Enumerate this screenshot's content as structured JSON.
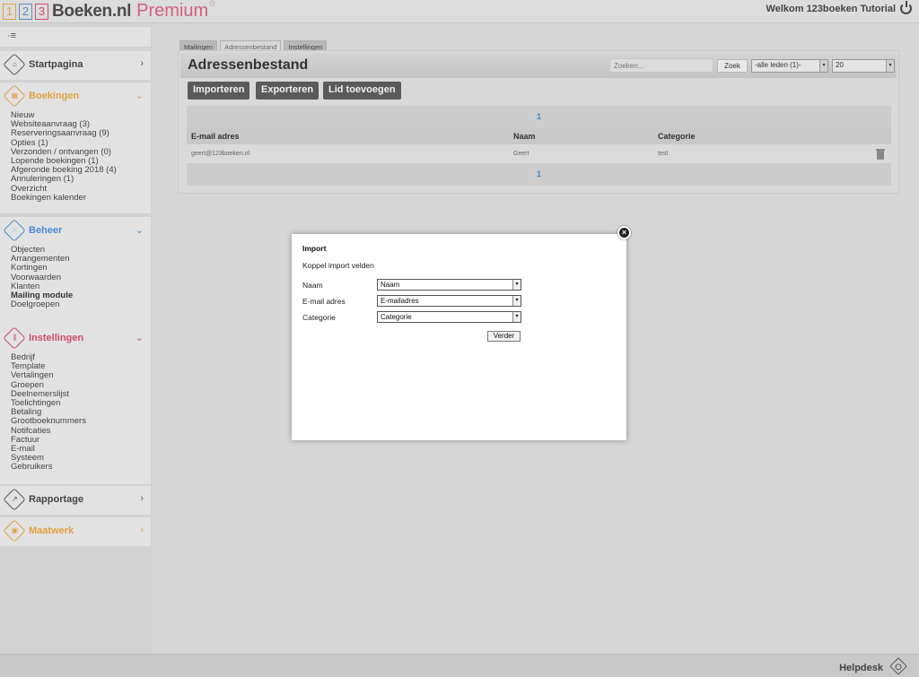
{
  "header": {
    "logo_digits": [
      "1",
      "2",
      "3"
    ],
    "brand": "Boeken.nl",
    "premium": "Premium",
    "star": "☆",
    "welcome": "Welkom 123boeken Tutorial"
  },
  "sidebar": {
    "collapse_glyph": "·≡",
    "startpagina": {
      "title": "Startpagina",
      "chev": "›"
    },
    "boekingen": {
      "title": "Boekingen",
      "chev": "⌄",
      "color": "#e0a040",
      "items": [
        "Nieuw",
        "Websiteaanvraag (3)",
        "Reserveringsaanvraag (9)",
        "Opties (1)",
        "Verzonden / ontvangen (0)",
        "Lopende boekingen (1)",
        "Afgeronde boeking 2018 (4)",
        "Annuleringen (1)",
        "Overzicht",
        "Boekingen kalender"
      ]
    },
    "beheer": {
      "title": "Beheer",
      "chev": "⌄",
      "color": "#4a8ad0",
      "items": [
        "Objecten",
        "Arrangementen",
        "Kortingen",
        "Voorwaarden",
        "Klanten",
        "Mailing module",
        "Doelgroepen"
      ]
    },
    "instellingen": {
      "title": "Instellingen",
      "chev": "⌄",
      "color": "#d04a6a",
      "items": [
        "Bedrijf",
        "Template",
        "Vertalingen",
        "Groepen",
        "Deelnemerslijst",
        "Toelichtingen",
        "Betaling",
        "Grootboeknummers",
        "Notifcaties",
        "Factuur",
        "E-mail",
        "Systeem",
        "Gebruikers"
      ]
    },
    "rapportage": {
      "title": "Rapportage",
      "chev": "›"
    },
    "maatwerk": {
      "title": "Maatwerk",
      "chev": "›",
      "color": "#e0a040"
    }
  },
  "main": {
    "tabs": [
      "Mailingen",
      "Adressenbestand",
      "Instellingen"
    ],
    "title": "Adressenbestand",
    "search_placeholder": "Zoeken...",
    "search_button": "Zoek",
    "filter_value": "-alle leden (1)-",
    "page_size": "20",
    "buttons": [
      "Importeren",
      "Exporteren",
      "Lid toevoegen"
    ],
    "pager": "1",
    "columns": [
      "E-mail adres",
      "Naam",
      "Categorie"
    ],
    "rows": [
      {
        "email": "geert@123boeken.nl",
        "naam": "Geert",
        "categorie": "test"
      }
    ]
  },
  "modal": {
    "title": "Import",
    "subtitle": "Koppel import velden",
    "fields": [
      {
        "label": "Naam",
        "value": "Naam"
      },
      {
        "label": "E-mail adres",
        "value": "E-mailadres"
      },
      {
        "label": "Categorie",
        "value": "Categorie"
      }
    ],
    "submit": "Verder",
    "close": "×"
  },
  "footer": {
    "helpdesk": "Helpdesk"
  }
}
